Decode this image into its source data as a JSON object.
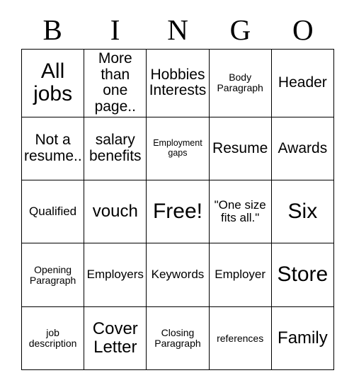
{
  "card": {
    "header_letters": [
      "B",
      "I",
      "N",
      "G",
      "O"
    ],
    "rows": [
      [
        {
          "text": "All jobs",
          "size": "fs-xxl"
        },
        {
          "text": "More than one page..",
          "size": "fs-l"
        },
        {
          "text": "Hobbies Interests",
          "size": "fs-l"
        },
        {
          "text": "Body Paragraph",
          "size": "fs-s"
        },
        {
          "text": "Header",
          "size": "fs-l"
        }
      ],
      [
        {
          "text": "Not a resume..",
          "size": "fs-l"
        },
        {
          "text": "salary benefits",
          "size": "fs-l"
        },
        {
          "text": "Employment gaps",
          "size": "fs-xs"
        },
        {
          "text": "Resume",
          "size": "fs-l"
        },
        {
          "text": "Awards",
          "size": "fs-l"
        }
      ],
      [
        {
          "text": "Qualified",
          "size": "fs-m"
        },
        {
          "text": "vouch",
          "size": "fs-xl"
        },
        {
          "text": "Free!",
          "size": "fs-xxl"
        },
        {
          "text": "\"One size fits all.\"",
          "size": "fs-m"
        },
        {
          "text": "Six",
          "size": "fs-xxl"
        }
      ],
      [
        {
          "text": "Opening Paragraph",
          "size": "fs-s"
        },
        {
          "text": "Employers",
          "size": "fs-m"
        },
        {
          "text": "Keywords",
          "size": "fs-m"
        },
        {
          "text": "Employer",
          "size": "fs-m"
        },
        {
          "text": "Store",
          "size": "fs-xxl"
        }
      ],
      [
        {
          "text": "job description",
          "size": "fs-s"
        },
        {
          "text": "Cover Letter",
          "size": "fs-xl"
        },
        {
          "text": "Closing Paragraph",
          "size": "fs-s"
        },
        {
          "text": "references",
          "size": "fs-s"
        },
        {
          "text": "Family",
          "size": "fs-xl"
        }
      ]
    ]
  }
}
